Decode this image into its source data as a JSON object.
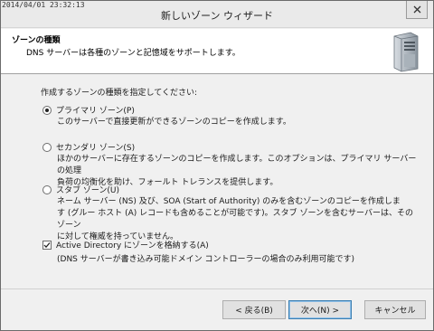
{
  "window": {
    "timestamp": "2014/04/01 23:32:13",
    "title": "新しいゾーン ウィザード"
  },
  "header": {
    "title": "ゾーンの種類",
    "subtitle": "DNS サーバーは各種のゾーンと記憶域をサポートします。",
    "icon": "server-icon"
  },
  "content": {
    "prompt": "作成するゾーンの種類を指定してください:",
    "options": [
      {
        "label": "プライマリ ゾーン(P)",
        "selected": true,
        "description": [
          "このサーバーで直接更新ができるゾーンのコピーを作成します。"
        ]
      },
      {
        "label": "セカンダリ ゾーン(S)",
        "selected": false,
        "description": [
          "ほかのサーバーに存在するゾーンのコピーを作成します。このオプションは、プライマリ サーバーの処理",
          "負荷の均衡化を助け、フォールト トレランスを提供します。"
        ]
      },
      {
        "label": "スタブ ゾーン(U)",
        "selected": false,
        "description": [
          "ネーム サーバー (NS) 及び、SOA (Start of Authority) のみを含むゾーンのコピーを作成しま",
          "す (グルー ホスト (A) レコードも含めることが可能です)。スタブ ゾーンを含むサーバーは、そのゾーン",
          "に対して権威を持っていません。"
        ]
      }
    ],
    "ad_checkbox": {
      "label": "Active Directory にゾーンを格納する(A)",
      "checked": true,
      "note": "(DNS サーバーが書き込み可能ドメイン コントローラーの場合のみ利用可能です)"
    }
  },
  "footer": {
    "back_label": "< 戻る(B)",
    "next_label": "次へ(N) >",
    "cancel_label": "キャンセル"
  },
  "colors": {
    "window_bg": "#f0f0f0",
    "header_bg": "#ffffff",
    "default_button_border": "#3c7fb1"
  }
}
